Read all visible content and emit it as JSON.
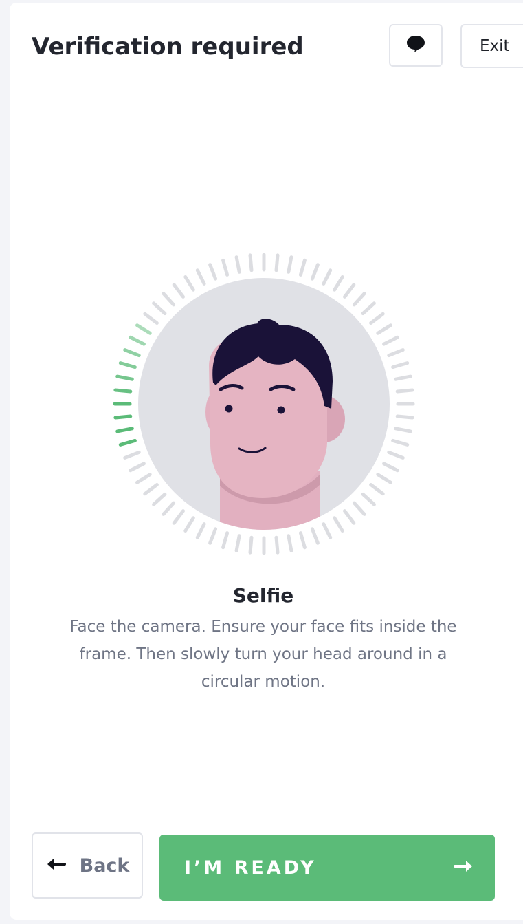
{
  "header": {
    "title": "Verification required",
    "chat_icon": "speech-bubble-icon",
    "exit_label": "Exit"
  },
  "selfie": {
    "heading": "Selfie",
    "description": "Face the camera. Ensure your face fits inside the frame. Then slowly turn your head around in a circular motion.",
    "progress_fraction": 0.16
  },
  "footer": {
    "back_label": "Back",
    "back_icon": "arrow-left-icon",
    "ready_label": "I’M READY",
    "ready_icon": "arrow-right-icon"
  },
  "colors": {
    "accent": "#5bbb78",
    "tick_inactive": "#dcdde1",
    "face_skin": "#e5b4c2",
    "hair": "#1a1238",
    "bg_circle": "#e0e1e6"
  }
}
